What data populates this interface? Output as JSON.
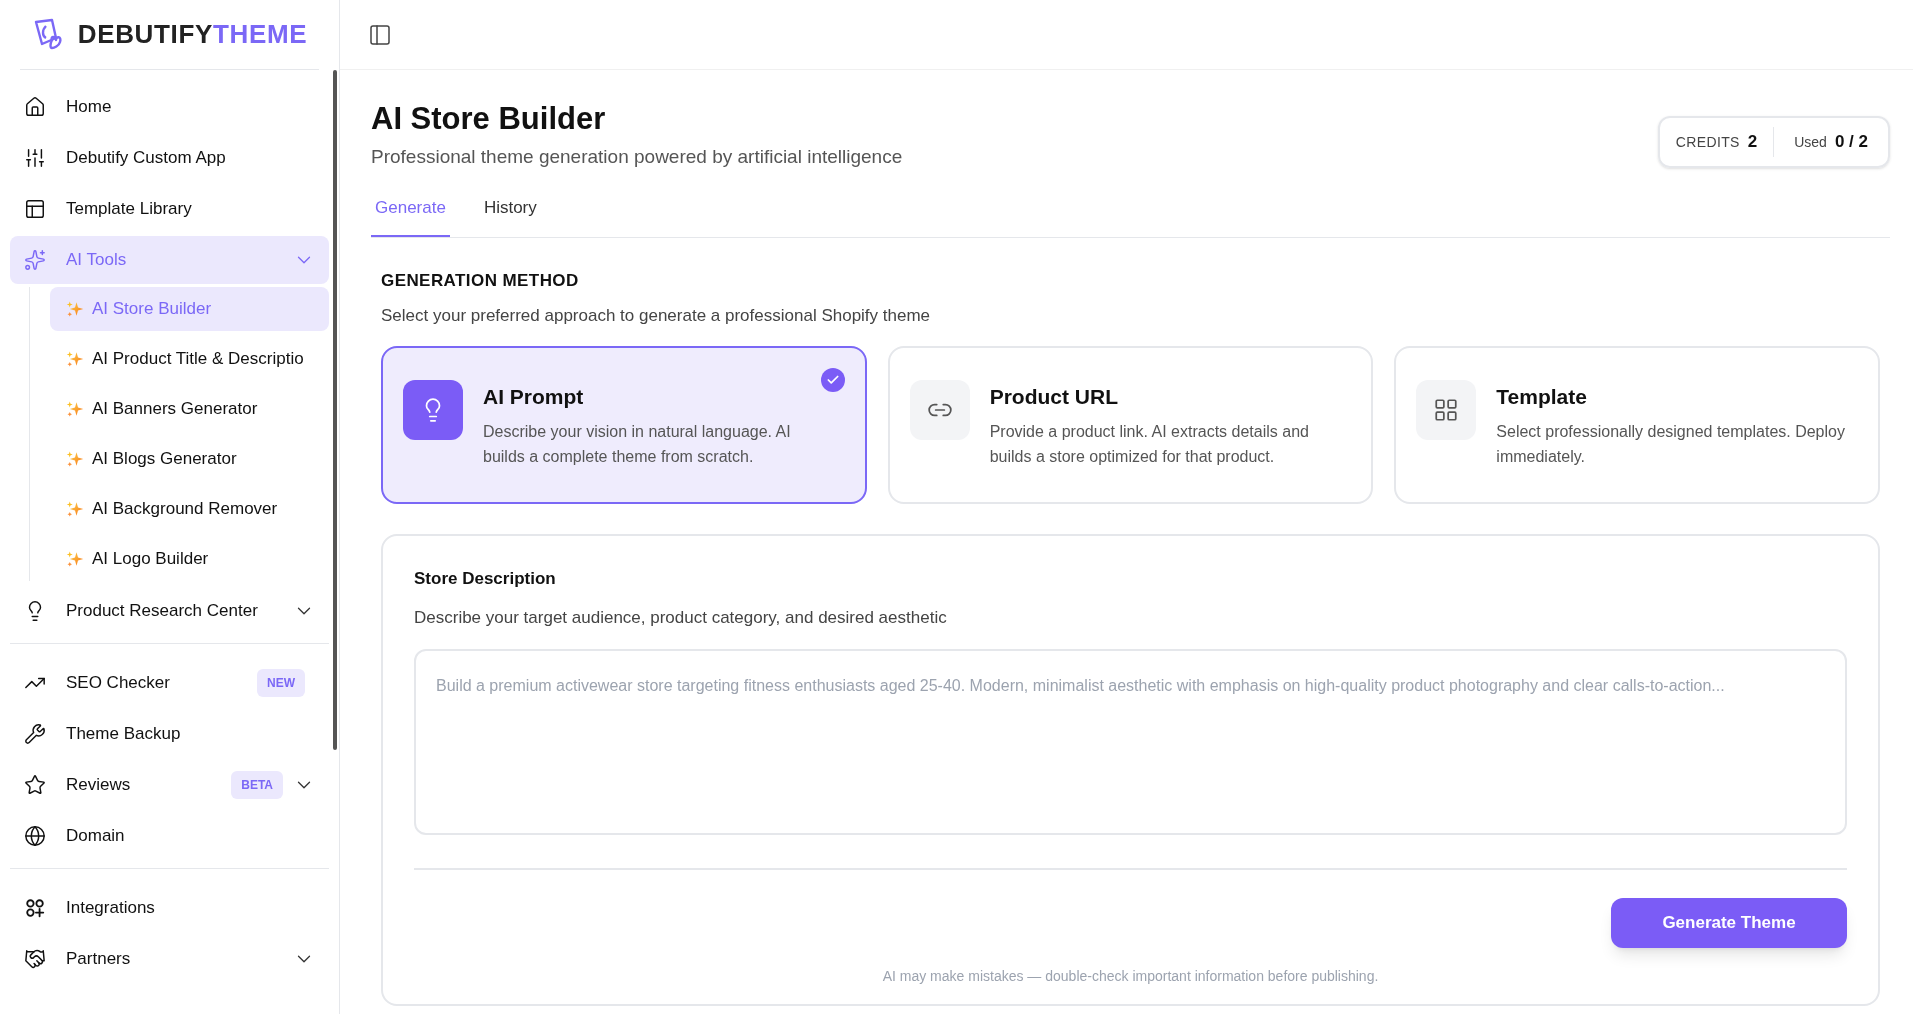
{
  "logo": {
    "primary": "DEBUTIFY",
    "accent": "THEME"
  },
  "sidebar": {
    "sections": [
      [
        {
          "label": "Home",
          "selected": false
        },
        {
          "label": "Debutify Custom App",
          "selected": false
        },
        {
          "label": "Template Library",
          "selected": false
        },
        {
          "label": "AI Tools",
          "selected": true,
          "expanded": true,
          "children": [
            {
              "label": "AI Store Builder",
              "selected": true
            },
            {
              "label": "AI Product Title & Descriptio",
              "selected": false
            },
            {
              "label": "AI Banners Generator",
              "selected": false
            },
            {
              "label": "AI Blogs Generator",
              "selected": false
            },
            {
              "label": "AI Background Remover",
              "selected": false
            },
            {
              "label": "AI Logo Builder",
              "selected": false
            }
          ]
        },
        {
          "label": "Product Research Center",
          "selected": false,
          "expanded": false
        }
      ],
      [
        {
          "label": "SEO Checker",
          "selected": false,
          "badge": "NEW"
        },
        {
          "label": "Theme Backup",
          "selected": false
        },
        {
          "label": "Reviews",
          "selected": false,
          "badge": "BETA",
          "expanded": false
        },
        {
          "label": "Domain",
          "selected": false
        }
      ],
      [
        {
          "label": "Integrations",
          "selected": false
        },
        {
          "label": "Partners",
          "selected": false,
          "expanded": false
        }
      ]
    ]
  },
  "header": {
    "title": "AI Store Builder",
    "subtitle": "Professional theme generation powered by artificial intelligence"
  },
  "credits": {
    "label": "CREDITS",
    "value": "2",
    "used_label": "Used",
    "used_value": "0 / 2"
  },
  "tabs": [
    {
      "label": "Generate",
      "selected": true
    },
    {
      "label": "History",
      "selected": false
    }
  ],
  "generation_method": {
    "heading": "GENERATION METHOD",
    "description": "Select your preferred approach to generate a professional Shopify theme",
    "options": [
      {
        "title": "AI Prompt",
        "description": "Describe your vision in natural language. AI builds a complete theme from scratch.",
        "selected": true
      },
      {
        "title": "Product URL",
        "description": "Provide a product link. AI extracts details and builds a store optimized for that product.",
        "selected": false
      },
      {
        "title": "Template",
        "description": "Select professionally designed templates. Deploy immediately.",
        "selected": false
      }
    ]
  },
  "store_description": {
    "title": "Store Description",
    "description": "Describe your target audience, product category, and desired aesthetic",
    "placeholder": "Build a premium activewear store targeting fitness enthusiasts aged 25-40. Modern, minimalist aesthetic with emphasis on high-quality product photography and clear calls-to-action...",
    "button": "Generate Theme",
    "disclaimer": "AI may make mistakes — double-check important information before publishing."
  }
}
